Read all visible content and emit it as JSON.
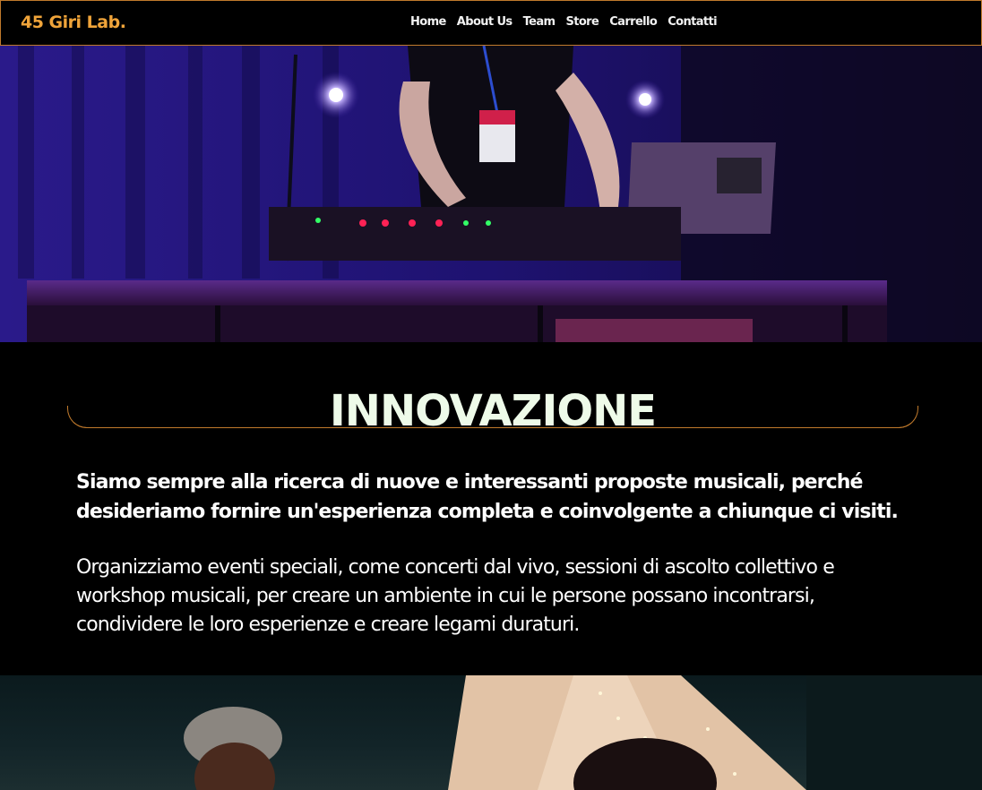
{
  "nav": {
    "brand": "45 Giri Lab.",
    "links": [
      "Home",
      "About Us",
      "Team",
      "Store",
      "Carrello",
      "Contatti"
    ]
  },
  "section": {
    "title": "INNOVAZIONE",
    "lead": "Siamo sempre alla ricerca di nuove e interessanti proposte musicali, perché desideriamo fornire un'esperienza completa e coinvolgente a chiunque ci visiti.",
    "body": "Organizziamo eventi speciali, come concerti dal vivo, sessioni di ascolto collettivo e workshop musicali, per creare un ambiente in cui le persone possano incontrarsi, condividere le loro esperienze e creare legami duraturi."
  },
  "colors": {
    "accent": "#f0a43a",
    "border": "#c07a2c",
    "title": "#eefbe9"
  },
  "images": {
    "hero_top": "dj-stage-photo",
    "hero_bottom": "tent-people-photo"
  }
}
